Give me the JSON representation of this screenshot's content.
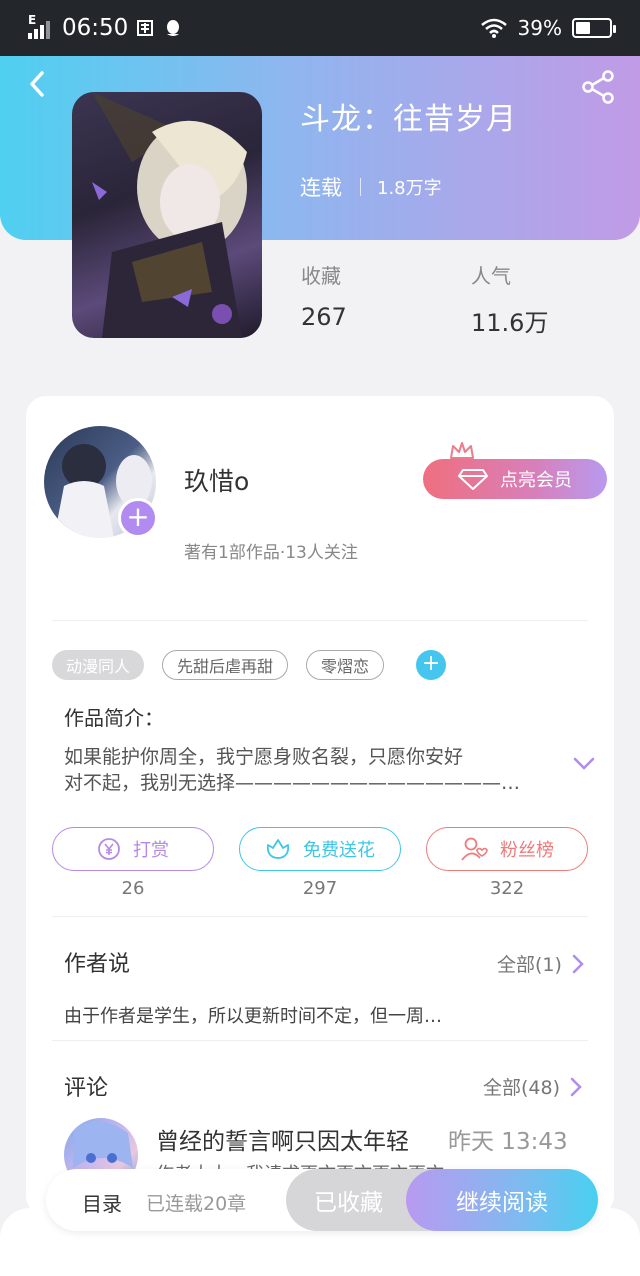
{
  "status_bar": {
    "time": "06:50",
    "network": "E",
    "battery": "39%"
  },
  "book": {
    "title": "斗龙：往昔岁月",
    "status": "连载",
    "word_count": "1.8万字",
    "stats": [
      {
        "label": "收藏",
        "value": "267"
      },
      {
        "label": "人气",
        "value": "11.6万"
      }
    ]
  },
  "author": {
    "name": "玖惜o",
    "meta": "著有1部作品·13人关注",
    "vip_label": "点亮会员"
  },
  "tags": [
    "动漫同人",
    "先甜后虐再甜",
    "零熠恋"
  ],
  "intro": {
    "title": "作品简介：",
    "line1": "如果能护你周全，我宁愿身败名裂，只愿你安好",
    "line2": "对不起，我别无选择——————————————…"
  },
  "actions": [
    {
      "label": "打赏",
      "count": "26",
      "color": "#b58ae6"
    },
    {
      "label": "免费送花",
      "count": "297",
      "color": "#3fc6e6"
    },
    {
      "label": "粉丝榜",
      "count": "322",
      "color": "#ee7b7b"
    }
  ],
  "author_says": {
    "title": "作者说",
    "more": "全部(1)",
    "text": "由于作者是学生，所以更新时间不定，但一周…"
  },
  "comments": {
    "title": "评论",
    "more": "全部(48)",
    "first": {
      "title": "曾经的誓言啊只因太年轻",
      "time": "昨天 13:43",
      "preview": "作者大大，我请求更文更文更文更文"
    }
  },
  "bottom_bar": {
    "toc": "目录",
    "serial": "已连载20章",
    "collected": "已收藏",
    "read": "继续阅读"
  },
  "colors": {
    "header_start": "#4fd0f0",
    "header_end": "#c19be6",
    "accent_purple": "#b18bef",
    "accent_blue": "#44c6ee"
  }
}
